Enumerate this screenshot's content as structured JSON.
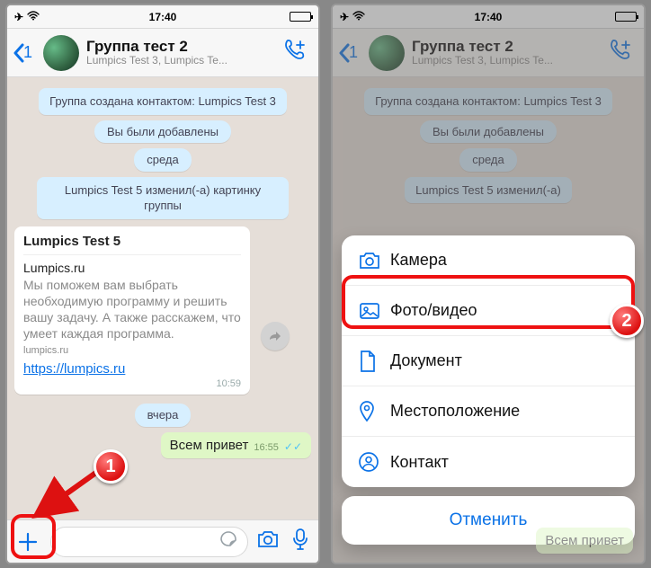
{
  "status": {
    "time": "17:40"
  },
  "header": {
    "back_count": "1",
    "title": "Группа тест 2",
    "subtitle": "Lumpics Test 3, Lumpics Te..."
  },
  "system_msgs": {
    "created": "Группа создана контактом: Lumpics Test 3",
    "added": "Вы были добавлены",
    "day1": "среда",
    "pic_changed": "Lumpics Test 5 изменил(-а) картинку группы",
    "pic_changed_short": "Lumpics Test 5 изменил(-а)",
    "day2": "вчера"
  },
  "link_card": {
    "sender": "Lumpics Test 5",
    "site_title": "Lumpics.ru",
    "description": "Мы поможем вам выбрать необходимую программу и решить вашу задачу. А также расскажем, что умеет каждая программа.",
    "footer_site": "lumpics.ru",
    "url_text": "https://lumpics.ru",
    "time": "10:59"
  },
  "outgoing": {
    "text": "Всем привет",
    "time": "16:55"
  },
  "action_sheet": {
    "items": [
      {
        "icon": "camera-icon",
        "label": "Камера"
      },
      {
        "icon": "photo-icon",
        "label": "Фото/видео"
      },
      {
        "icon": "document-icon",
        "label": "Документ"
      },
      {
        "icon": "location-icon",
        "label": "Местоположение"
      },
      {
        "icon": "contact-icon",
        "label": "Контакт"
      }
    ],
    "cancel": "Отменить"
  },
  "annotations": {
    "step1": "1",
    "step2": "2"
  }
}
